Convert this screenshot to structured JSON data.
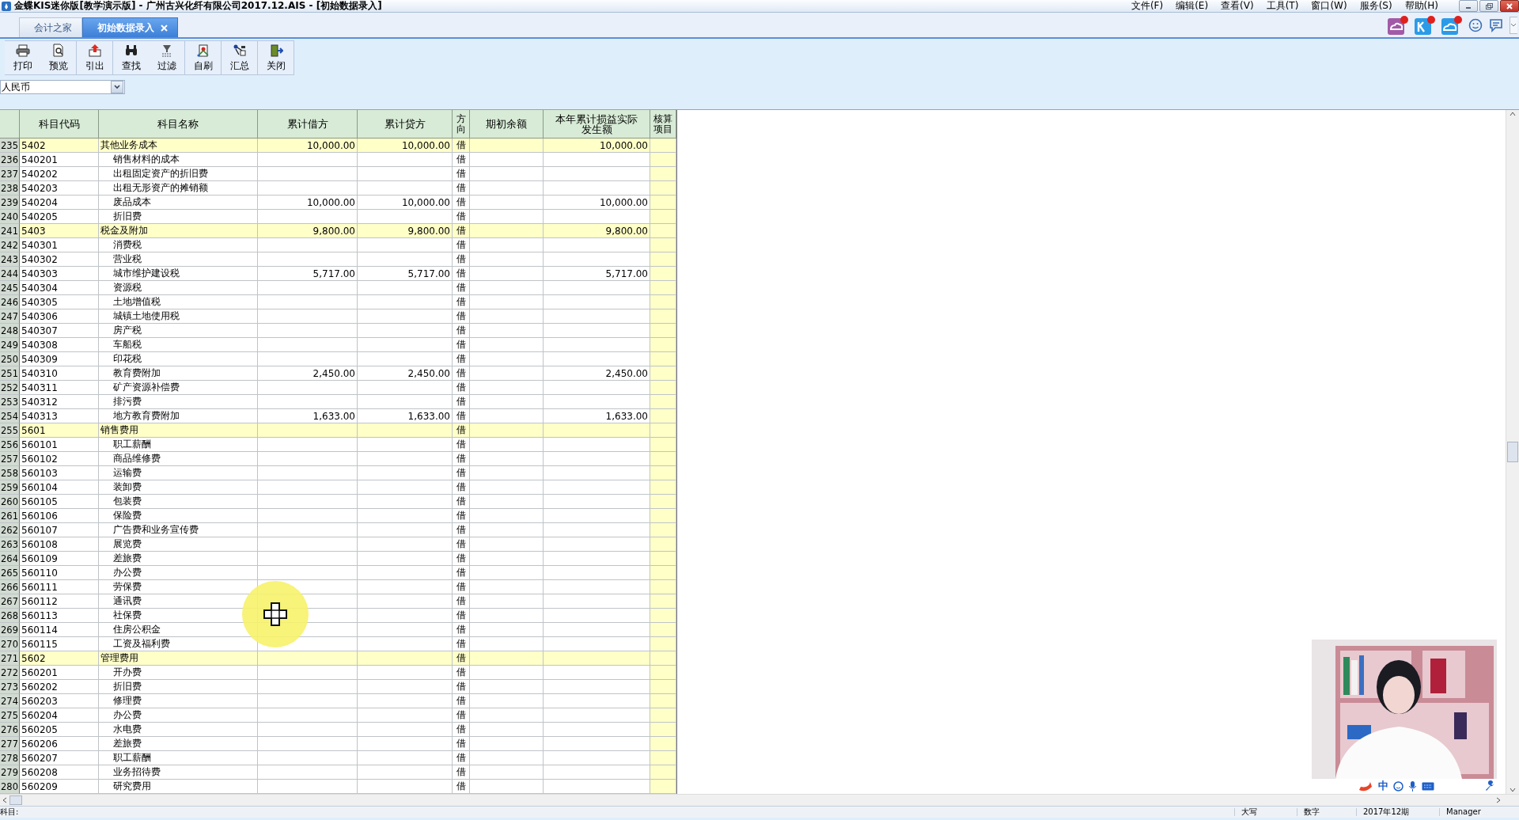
{
  "window": {
    "title": "金蝶KIS迷你版[教学演示版] - 广州古兴化纤有限公司2017.12.AIS - [初始数据录入]"
  },
  "menu": [
    "文件(F)",
    "编辑(E)",
    "查看(V)",
    "工具(T)",
    "窗口(W)",
    "服务(S)",
    "帮助(H)"
  ],
  "tabs": [
    {
      "label": "会计之家",
      "selected": false,
      "closable": false
    },
    {
      "label": "初始数据录入",
      "selected": true,
      "closable": true
    }
  ],
  "toolbar": [
    [
      "打印",
      "预览"
    ],
    [
      "引出"
    ],
    [
      "查找",
      "过滤"
    ],
    [
      "自刷"
    ],
    [
      "汇总"
    ],
    [
      "关闭"
    ]
  ],
  "currency": {
    "value": "人民币"
  },
  "table": {
    "columns": [
      "科目代码",
      "科目名称",
      "累计借方",
      "累计贷方",
      "方向",
      "期初余额",
      "本年累计损益实际发生额",
      "核算项目"
    ],
    "rows": [
      {
        "row": "235",
        "code": "5402",
        "name": "其他业务成本",
        "debit": "10,000.00",
        "credit": "10,000.00",
        "direction": "借",
        "annual": "10,000.00",
        "children": [
          {
            "row": "236",
            "code": "540201",
            "name": "销售材料的成本",
            "direction": "借"
          },
          {
            "row": "237",
            "code": "540202",
            "name": "出租固定资产的折旧费",
            "direction": "借"
          },
          {
            "row": "238",
            "code": "540203",
            "name": "出租无形资产的摊销额",
            "direction": "借"
          },
          {
            "row": "239",
            "code": "540204",
            "name": "废品成本",
            "debit": "10,000.00",
            "credit": "10,000.00",
            "direction": "借",
            "annual": "10,000.00"
          },
          {
            "row": "240",
            "code": "540205",
            "name": "折旧费",
            "direction": "借"
          }
        ]
      },
      {
        "row": "241",
        "code": "5403",
        "name": "税金及附加",
        "debit": "9,800.00",
        "credit": "9,800.00",
        "direction": "借",
        "annual": "9,800.00",
        "children": [
          {
            "row": "242",
            "code": "540301",
            "name": "消费税",
            "direction": "借"
          },
          {
            "row": "243",
            "code": "540302",
            "name": "营业税",
            "direction": "借"
          },
          {
            "row": "244",
            "code": "540303",
            "name": "城市维护建设税",
            "debit": "5,717.00",
            "credit": "5,717.00",
            "direction": "借",
            "annual": "5,717.00"
          },
          {
            "row": "245",
            "code": "540304",
            "name": "资源税",
            "direction": "借"
          },
          {
            "row": "246",
            "code": "540305",
            "name": "土地增值税",
            "direction": "借"
          },
          {
            "row": "247",
            "code": "540306",
            "name": "城镇土地使用税",
            "direction": "借"
          },
          {
            "row": "248",
            "code": "540307",
            "name": "房产税",
            "direction": "借"
          },
          {
            "row": "249",
            "code": "540308",
            "name": "车船税",
            "direction": "借"
          },
          {
            "row": "250",
            "code": "540309",
            "name": "印花税",
            "direction": "借"
          },
          {
            "row": "251",
            "code": "540310",
            "name": "教育费附加",
            "debit": "2,450.00",
            "credit": "2,450.00",
            "direction": "借",
            "annual": "2,450.00"
          },
          {
            "row": "252",
            "code": "540311",
            "name": "矿产资源补偿费",
            "direction": "借"
          },
          {
            "row": "253",
            "code": "540312",
            "name": "排污费",
            "direction": "借"
          },
          {
            "row": "254",
            "code": "540313",
            "name": "地方教育费附加",
            "debit": "1,633.00",
            "credit": "1,633.00",
            "direction": "借",
            "annual": "1,633.00"
          }
        ]
      },
      {
        "row": "255",
        "code": "5601",
        "name": "销售费用",
        "direction": "借",
        "children": [
          {
            "row": "256",
            "code": "560101",
            "name": "职工薪酬",
            "direction": "借"
          },
          {
            "row": "257",
            "code": "560102",
            "name": "商品维修费",
            "direction": "借"
          },
          {
            "row": "258",
            "code": "560103",
            "name": "运输费",
            "direction": "借"
          },
          {
            "row": "259",
            "code": "560104",
            "name": "装卸费",
            "direction": "借"
          },
          {
            "row": "260",
            "code": "560105",
            "name": "包装费",
            "direction": "借"
          },
          {
            "row": "261",
            "code": "560106",
            "name": "保险费",
            "direction": "借"
          },
          {
            "row": "262",
            "code": "560107",
            "name": "广告费和业务宣传费",
            "direction": "借"
          },
          {
            "row": "263",
            "code": "560108",
            "name": "展览费",
            "direction": "借"
          },
          {
            "row": "264",
            "code": "560109",
            "name": "差旅费",
            "direction": "借"
          },
          {
            "row": "265",
            "code": "560110",
            "name": "办公费",
            "direction": "借"
          },
          {
            "row": "266",
            "code": "560111",
            "name": "劳保费",
            "direction": "借"
          },
          {
            "row": "267",
            "code": "560112",
            "name": "通讯费",
            "direction": "借"
          },
          {
            "row": "268",
            "code": "560113",
            "name": "社保费",
            "direction": "借"
          },
          {
            "row": "269",
            "code": "560114",
            "name": "住房公积金",
            "direction": "借"
          },
          {
            "row": "270",
            "code": "560115",
            "name": "工资及福利费",
            "direction": "借"
          }
        ]
      },
      {
        "row": "271",
        "code": "5602",
        "name": "管理费用",
        "direction": "借",
        "children": [
          {
            "row": "272",
            "code": "560201",
            "name": "开办费",
            "direction": "借"
          },
          {
            "row": "273",
            "code": "560202",
            "name": "折旧费",
            "direction": "借"
          },
          {
            "row": "274",
            "code": "560203",
            "name": "修理费",
            "direction": "借"
          },
          {
            "row": "275",
            "code": "560204",
            "name": "办公费",
            "direction": "借"
          },
          {
            "row": "276",
            "code": "560205",
            "name": "水电费",
            "direction": "借"
          },
          {
            "row": "277",
            "code": "560206",
            "name": "差旅费",
            "direction": "借"
          },
          {
            "row": "278",
            "code": "560207",
            "name": "职工薪酬",
            "direction": "借"
          },
          {
            "row": "279",
            "code": "560208",
            "name": "业务招待费",
            "direction": "借"
          },
          {
            "row": "280",
            "code": "560209",
            "name": "研究费用",
            "direction": "借"
          }
        ]
      }
    ]
  },
  "webcam": {
    "kind": "picture"
  },
  "ime_bar": {
    "mode": "中"
  },
  "status_bar": {
    "subject": "科目:",
    "caps": "大写",
    "num": "数字",
    "period": "2017年12期",
    "user": "Manager"
  }
}
